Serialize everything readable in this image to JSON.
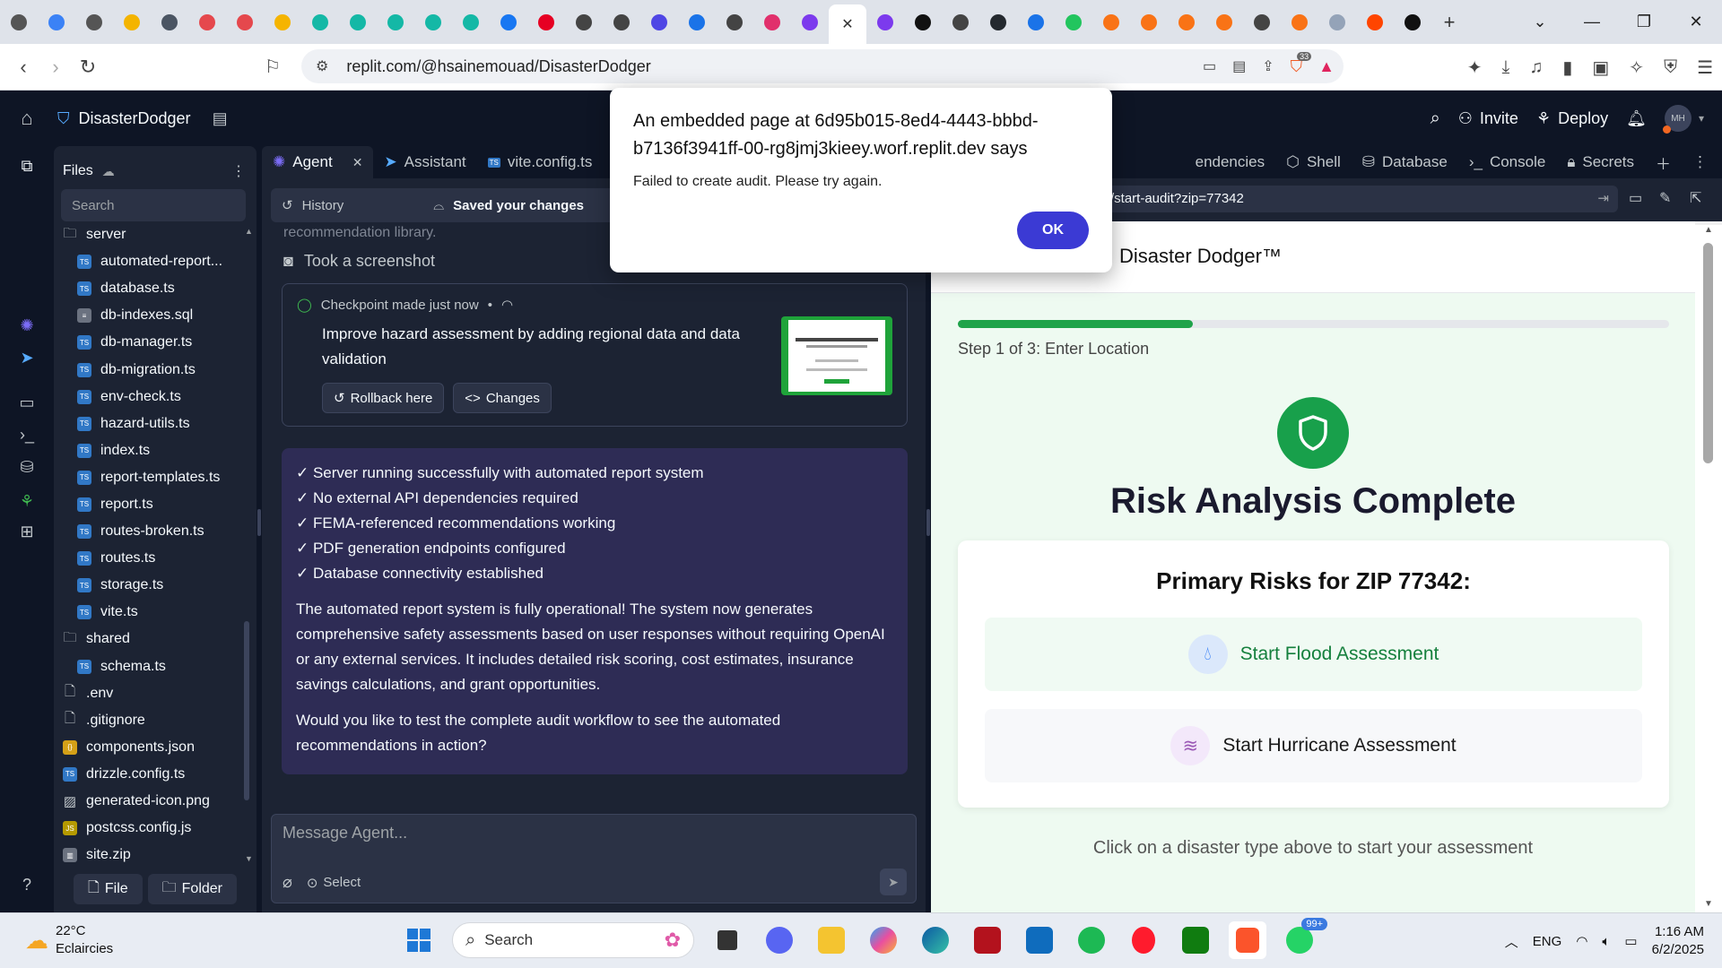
{
  "browser": {
    "url": "replit.com/@hsainemouad/DisasterDodger",
    "extension_badge": "33",
    "window_controls": [
      "chevron-down",
      "minimize",
      "restore",
      "close"
    ]
  },
  "replit": {
    "project_name": "DisasterDodger",
    "invite_label": "Invite",
    "deploy_label": "Deploy",
    "avatar_initials": "MH"
  },
  "files": {
    "title": "Files",
    "search_placeholder": "Search",
    "items": [
      {
        "name": "server",
        "type": "folder"
      },
      {
        "name": "automated-report...",
        "type": "ts"
      },
      {
        "name": "database.ts",
        "type": "ts"
      },
      {
        "name": "db-indexes.sql",
        "type": "sql"
      },
      {
        "name": "db-manager.ts",
        "type": "ts"
      },
      {
        "name": "db-migration.ts",
        "type": "ts"
      },
      {
        "name": "env-check.ts",
        "type": "ts"
      },
      {
        "name": "hazard-utils.ts",
        "type": "ts"
      },
      {
        "name": "index.ts",
        "type": "ts"
      },
      {
        "name": "report-templates.ts",
        "type": "ts"
      },
      {
        "name": "report.ts",
        "type": "ts"
      },
      {
        "name": "routes-broken.ts",
        "type": "ts"
      },
      {
        "name": "routes.ts",
        "type": "ts"
      },
      {
        "name": "storage.ts",
        "type": "ts"
      },
      {
        "name": "vite.ts",
        "type": "ts"
      },
      {
        "name": "shared",
        "type": "folder"
      },
      {
        "name": "schema.ts",
        "type": "ts"
      },
      {
        "name": ".env",
        "type": "file"
      },
      {
        "name": ".gitignore",
        "type": "file"
      },
      {
        "name": "components.json",
        "type": "json"
      },
      {
        "name": "drizzle.config.ts",
        "type": "ts"
      },
      {
        "name": "generated-icon.png",
        "type": "image"
      },
      {
        "name": "postcss.config.js",
        "type": "js"
      },
      {
        "name": "site.zip",
        "type": "zip"
      }
    ],
    "new_file_label": "File",
    "new_folder_label": "Folder"
  },
  "agent": {
    "tabs": [
      {
        "label": "Agent",
        "active": true
      },
      {
        "label": "Assistant"
      },
      {
        "label": "vite.config.ts"
      }
    ],
    "history_label": "History",
    "saved_label": "Saved your changes",
    "cut_text": "recommendation library.",
    "screenshot_label": "Took a screenshot",
    "checkpoint": {
      "header": "Checkpoint made just now",
      "separator": "•",
      "title": "Improve hazard assessment by adding regional data and data validation",
      "rollback_label": "Rollback here",
      "changes_label": "Changes"
    },
    "message": {
      "checks": [
        "✓ Server running successfully with automated report system",
        "✓ No external API dependencies required",
        "✓ FEMA-referenced recommendations working",
        "✓ PDF generation endpoints configured",
        "✓ Database connectivity established"
      ],
      "paragraph1": "The automated report system is fully operational! The system now generates comprehensive safety assessments based on user responses without requiring OpenAI or any external services. It includes detailed risk scoring, cost estimates, insurance savings calculations, and grant opportunities.",
      "paragraph2": "Would you like to test the complete audit workflow to see the automated recommendations in action?"
    },
    "composer_placeholder": "Message Agent...",
    "select_label": "Select"
  },
  "webview": {
    "tabs": [
      "endencies",
      "Shell",
      "Database",
      "Console",
      "Secrets"
    ],
    "url_path": "/start-audit?zip=77342",
    "brand": "Disaster Dodger™",
    "progress_fraction": 0.33,
    "step_text": "Step 1 of 3: Enter Location",
    "title": "Risk Analysis Complete",
    "card_title": "Primary Risks for ZIP 77342:",
    "flood_label": "Start Flood Assessment",
    "hurricane_label": "Start Hurricane Assessment",
    "hint": "Click on a disaster type above to start your assessment",
    "colors": {
      "accent_green": "#18a04b",
      "flood_text": "#15803d",
      "hurricane_icon": "#9b59b6"
    }
  },
  "dialog": {
    "title": "An embedded page at 6d95b015-8ed4-4443-bbbd-b7136f3941ff-00-rg8jmj3kieey.worf.replit.dev says",
    "message": "Failed to create audit. Please try again.",
    "ok_label": "OK"
  },
  "taskbar": {
    "temperature": "22°C",
    "condition": "Eclaircies",
    "search_placeholder": "Search",
    "whatsapp_badge": "99+",
    "language": "ENG",
    "time": "1:16 AM",
    "date": "6/2/2025"
  }
}
